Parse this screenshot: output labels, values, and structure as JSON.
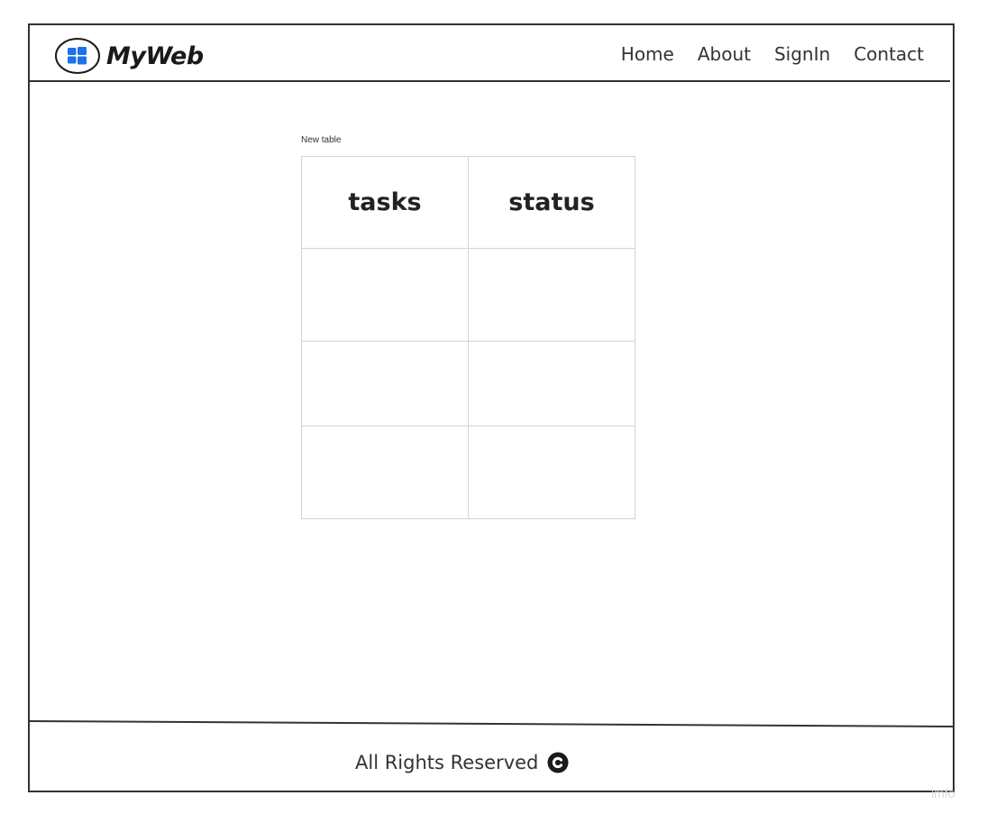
{
  "header": {
    "brand_name": "MyWeb",
    "logo_icon": "windows-logo-icon",
    "nav": [
      {
        "label": "Home"
      },
      {
        "label": "About"
      },
      {
        "label": "SignIn"
      },
      {
        "label": "Contact"
      }
    ]
  },
  "main": {
    "table_caption": "New table",
    "table": {
      "columns": [
        "tasks",
        "status"
      ],
      "rows": [
        [
          "",
          ""
        ],
        [
          "",
          ""
        ],
        [
          "",
          ""
        ]
      ]
    }
  },
  "footer": {
    "text": "All Rights Reserved",
    "icon": "copyright-icon"
  },
  "watermark": "imfo",
  "colors": {
    "logo_blue": "#1a73e8",
    "border": "#333333",
    "table_border": "#d4d4d4"
  }
}
